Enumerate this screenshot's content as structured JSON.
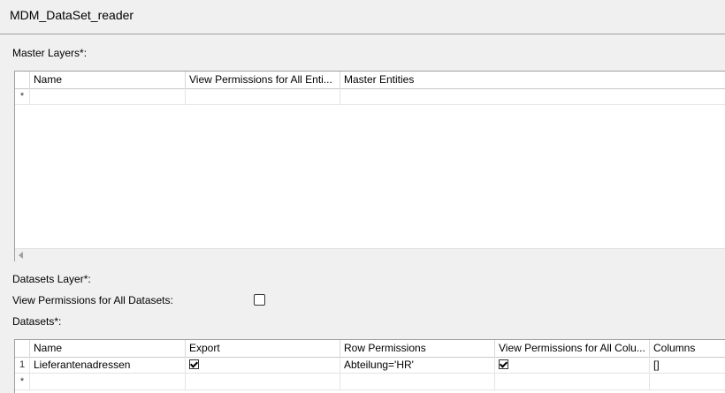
{
  "window": {
    "title": "MDM_DataSet_reader"
  },
  "master_layers": {
    "label": "Master Layers*:",
    "columns": [
      "Name",
      "View Permissions for All Enti...",
      "Master Entities"
    ],
    "new_row_marker": "*"
  },
  "datasets_layer": {
    "label": "Datasets Layer*:"
  },
  "view_all_datasets": {
    "label": "View Permissions for All Datasets:",
    "checked": false
  },
  "datasets": {
    "label": "Datasets*:",
    "columns": [
      "Name",
      "Export",
      "Row Permissions",
      "View Permissions for All Colu...",
      "Columns"
    ],
    "rows": [
      {
        "index": "1",
        "name": "Lieferantenadressen",
        "export": true,
        "row_permissions": "Abteilung='HR'",
        "view_all_columns": true,
        "columns": "[]"
      }
    ],
    "new_row_marker": "*"
  }
}
